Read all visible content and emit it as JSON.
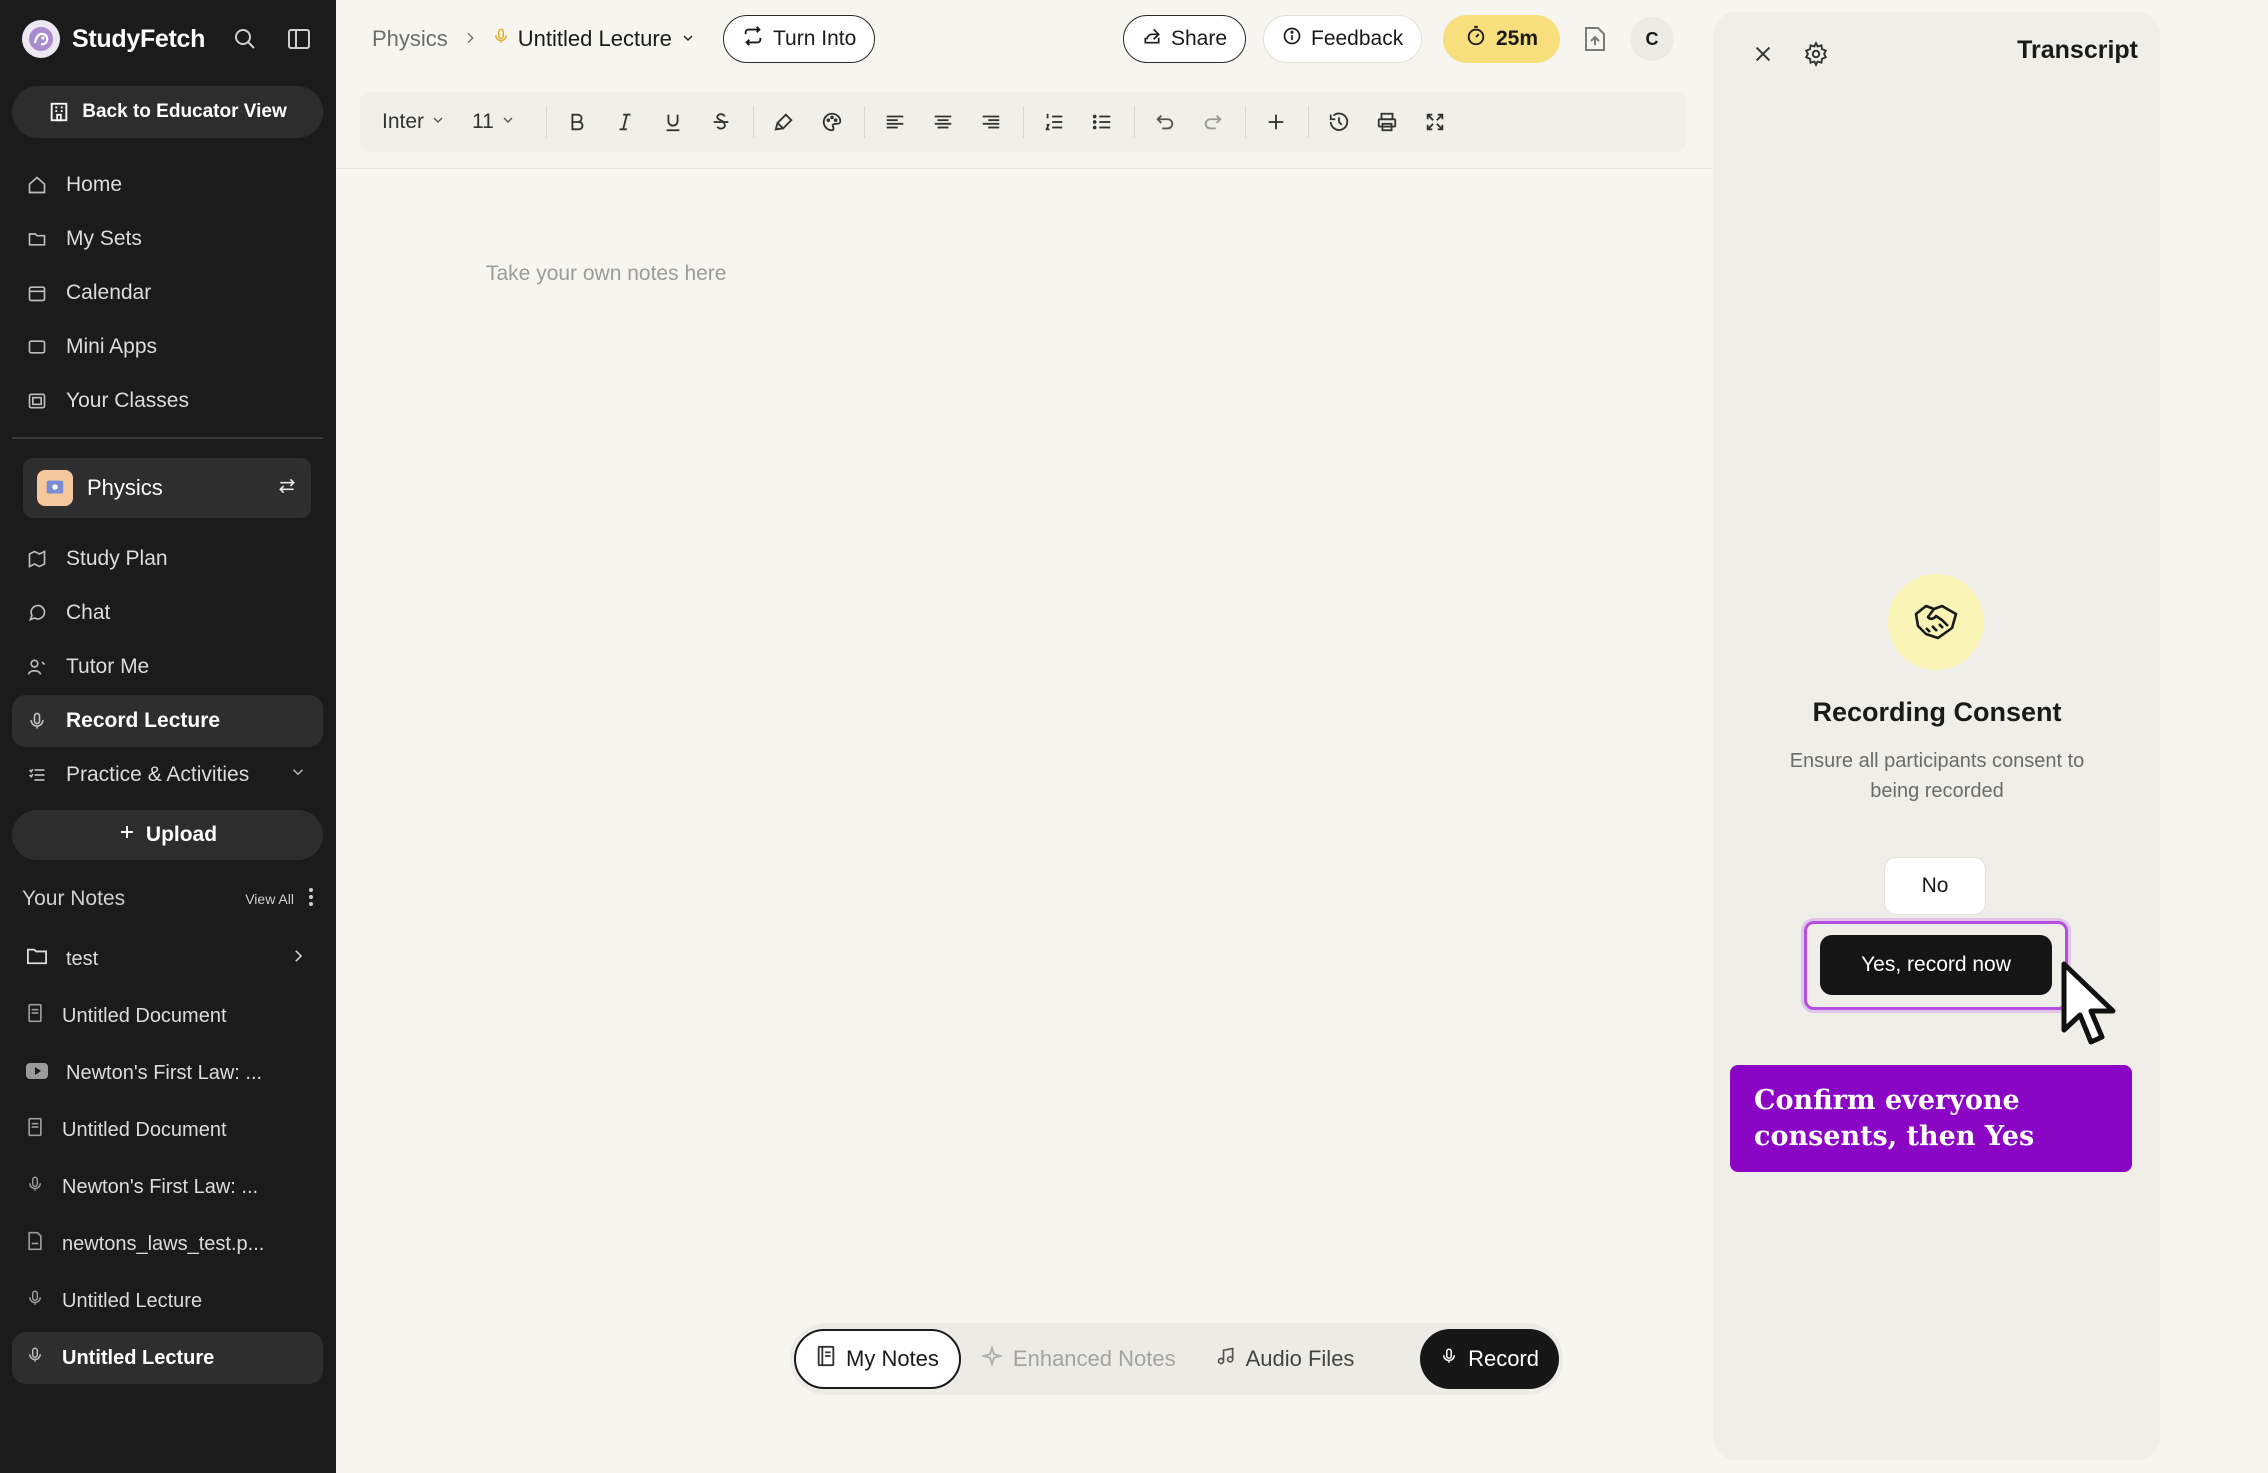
{
  "app": {
    "name": "StudyFetch"
  },
  "sidebar": {
    "back_label": "Back to Educator View",
    "nav": [
      {
        "label": "Home",
        "icon": "home-icon"
      },
      {
        "label": "My Sets",
        "icon": "folder-icon"
      },
      {
        "label": "Calendar",
        "icon": "calendar-icon"
      },
      {
        "label": "Mini Apps",
        "icon": "app-icon"
      },
      {
        "label": "Your Classes",
        "icon": "class-icon"
      }
    ],
    "current_class": "Physics",
    "class_nav": [
      {
        "label": "Study Plan",
        "icon": "map-icon"
      },
      {
        "label": "Chat",
        "icon": "chat-icon"
      },
      {
        "label": "Tutor Me",
        "icon": "tutor-icon"
      },
      {
        "label": "Record Lecture",
        "icon": "mic-icon",
        "active": true
      },
      {
        "label": "Practice & Activities",
        "icon": "list-icon"
      }
    ],
    "upload_label": "Upload",
    "notes_header": "Your Notes",
    "view_all": "View All",
    "notes": [
      {
        "label": "test",
        "icon": "folder-icon"
      },
      {
        "label": "Untitled Document",
        "icon": "document-icon"
      },
      {
        "label": "Newton's First Law: ...",
        "icon": "youtube-icon"
      },
      {
        "label": "Untitled Document",
        "icon": "document-icon"
      },
      {
        "label": "Newton's First Law: ...",
        "icon": "mic-icon"
      },
      {
        "label": "newtons_laws_test.p...",
        "icon": "pdf-icon"
      },
      {
        "label": "Untitled Lecture",
        "icon": "mic-icon"
      },
      {
        "label": "Untitled Lecture",
        "icon": "mic-icon",
        "active": true
      }
    ]
  },
  "header": {
    "breadcrumb_root": "Physics",
    "lecture_title": "Untitled Lecture",
    "turn_into": "Turn Into",
    "share": "Share",
    "feedback": "Feedback",
    "timer": "25m",
    "avatar_initial": "C"
  },
  "toolbar": {
    "font": "Inter",
    "size": "11"
  },
  "editor": {
    "placeholder": "Take your own notes here"
  },
  "bottom_tabs": {
    "my_notes": "My Notes",
    "enhanced_notes": "Enhanced Notes",
    "audio_files": "Audio Files",
    "record": "Record"
  },
  "transcript": {
    "title": "Transcript",
    "consent_title": "Recording Consent",
    "consent_desc": "Ensure all participants consent to being recorded",
    "no_label": "No",
    "yes_label": "Yes, record now",
    "tooltip": "Confirm everyone consents, then Yes"
  },
  "colors": {
    "accent_purple": "#8a06c4",
    "timer_yellow": "#f7df7d",
    "sidebar_bg": "#1b1b1b"
  }
}
